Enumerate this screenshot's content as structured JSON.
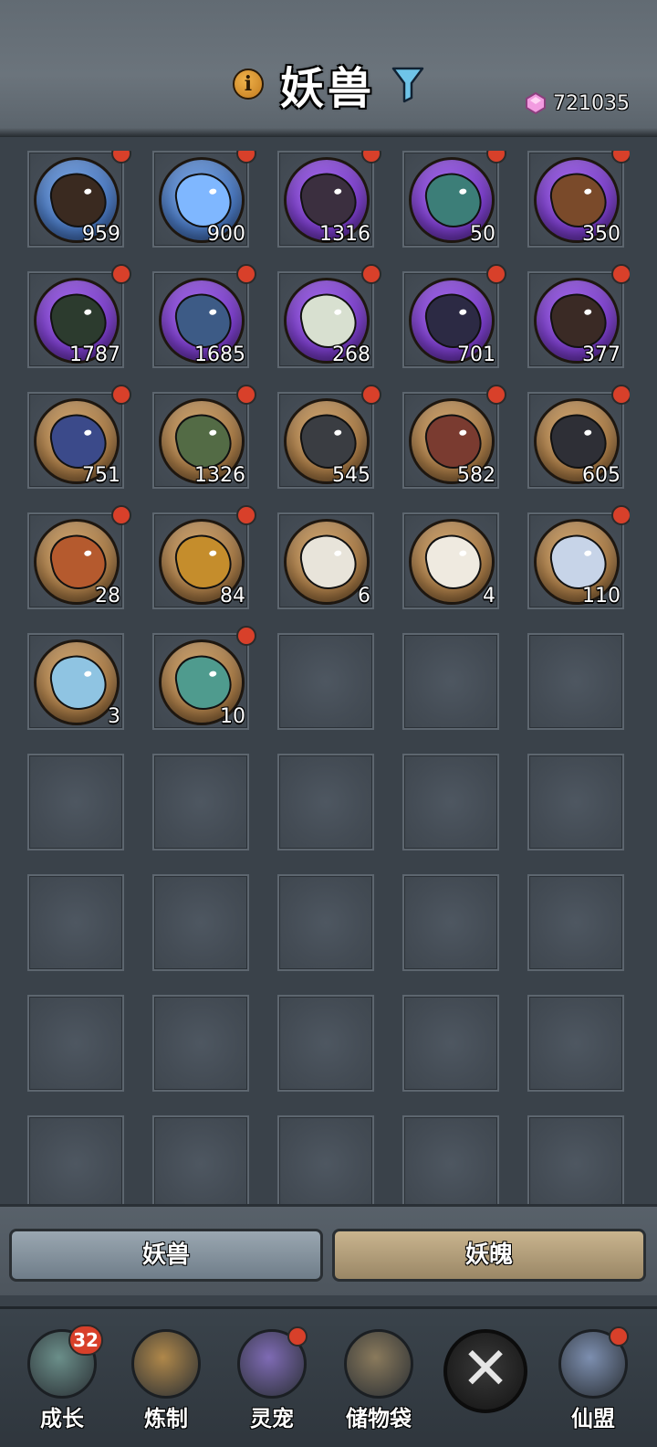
{
  "header": {
    "title": "妖兽",
    "info_icon": "i",
    "currency": {
      "icon": "pink-gem-icon",
      "value": "721035"
    }
  },
  "grid": {
    "slots": [
      {
        "count": "959",
        "orb": "blue",
        "beast_color": "#3a2a20",
        "badge": true
      },
      {
        "count": "900",
        "orb": "blue",
        "beast_color": "#7fb7ff",
        "badge": true
      },
      {
        "count": "1316",
        "orb": "purple",
        "beast_color": "#3b2f3f",
        "badge": true
      },
      {
        "count": "50",
        "orb": "purple",
        "beast_color": "#3c7e78",
        "badge": true
      },
      {
        "count": "350",
        "orb": "purple",
        "beast_color": "#7a4a2a",
        "badge": true
      },
      {
        "count": "1787",
        "orb": "purple",
        "beast_color": "#2c3b2e",
        "badge": true
      },
      {
        "count": "1685",
        "orb": "purple",
        "beast_color": "#3d5b86",
        "badge": true
      },
      {
        "count": "268",
        "orb": "purple",
        "beast_color": "#d8e0d0",
        "badge": true
      },
      {
        "count": "701",
        "orb": "purple",
        "beast_color": "#2c2a44",
        "badge": true
      },
      {
        "count": "377",
        "orb": "purple",
        "beast_color": "#3a2a25",
        "badge": true
      },
      {
        "count": "751",
        "orb": "tan",
        "beast_color": "#3b4a8a",
        "badge": true
      },
      {
        "count": "1326",
        "orb": "tan",
        "beast_color": "#536b45",
        "badge": true
      },
      {
        "count": "545",
        "orb": "tan",
        "beast_color": "#3a3d42",
        "badge": true
      },
      {
        "count": "582",
        "orb": "tan",
        "beast_color": "#7a3b30",
        "badge": true
      },
      {
        "count": "605",
        "orb": "tan",
        "beast_color": "#2e2f36",
        "badge": true
      },
      {
        "count": "28",
        "orb": "tan",
        "beast_color": "#b55a2e",
        "badge": true
      },
      {
        "count": "84",
        "orb": "tan",
        "beast_color": "#c58d2c",
        "badge": true
      },
      {
        "count": "6",
        "orb": "tan",
        "beast_color": "#e8e4da",
        "badge": false
      },
      {
        "count": "4",
        "orb": "tan",
        "beast_color": "#efeae0",
        "badge": false
      },
      {
        "count": "110",
        "orb": "tan",
        "beast_color": "#c7d4e8",
        "badge": true
      },
      {
        "count": "3",
        "orb": "tan",
        "beast_color": "#8fc4e2",
        "badge": false
      },
      {
        "count": "10",
        "orb": "tan",
        "beast_color": "#4f9b8e",
        "badge": true
      },
      {
        "count": "",
        "orb": "",
        "beast_color": "",
        "badge": false
      },
      {
        "count": "",
        "orb": "",
        "beast_color": "",
        "badge": false
      },
      {
        "count": "",
        "orb": "",
        "beast_color": "",
        "badge": false
      },
      {
        "count": "",
        "orb": "",
        "beast_color": "",
        "badge": false
      },
      {
        "count": "",
        "orb": "",
        "beast_color": "",
        "badge": false
      },
      {
        "count": "",
        "orb": "",
        "beast_color": "",
        "badge": false
      },
      {
        "count": "",
        "orb": "",
        "beast_color": "",
        "badge": false
      },
      {
        "count": "",
        "orb": "",
        "beast_color": "",
        "badge": false
      },
      {
        "count": "",
        "orb": "",
        "beast_color": "",
        "badge": false
      },
      {
        "count": "",
        "orb": "",
        "beast_color": "",
        "badge": false
      },
      {
        "count": "",
        "orb": "",
        "beast_color": "",
        "badge": false
      },
      {
        "count": "",
        "orb": "",
        "beast_color": "",
        "badge": false
      },
      {
        "count": "",
        "orb": "",
        "beast_color": "",
        "badge": false
      },
      {
        "count": "",
        "orb": "",
        "beast_color": "",
        "badge": false
      },
      {
        "count": "",
        "orb": "",
        "beast_color": "",
        "badge": false
      },
      {
        "count": "",
        "orb": "",
        "beast_color": "",
        "badge": false
      },
      {
        "count": "",
        "orb": "",
        "beast_color": "",
        "badge": false
      },
      {
        "count": "",
        "orb": "",
        "beast_color": "",
        "badge": false
      },
      {
        "count": "",
        "orb": "",
        "beast_color": "",
        "badge": false
      },
      {
        "count": "",
        "orb": "",
        "beast_color": "",
        "badge": false
      },
      {
        "count": "",
        "orb": "",
        "beast_color": "",
        "badge": false
      },
      {
        "count": "",
        "orb": "",
        "beast_color": "",
        "badge": false
      },
      {
        "count": "",
        "orb": "",
        "beast_color": "",
        "badge": false
      }
    ]
  },
  "tabs": {
    "left_label": "妖兽",
    "right_label": "妖魄"
  },
  "bottom_nav": {
    "items": [
      {
        "label": "成长",
        "icon": "growth-icon",
        "icon_color": "#6b8f8a",
        "badge_count": "32"
      },
      {
        "label": "炼制",
        "icon": "forge-icon",
        "icon_color": "#b0884a"
      },
      {
        "label": "灵宠",
        "icon": "spirit-pet-icon",
        "icon_color": "#7f6bb5"
      },
      {
        "label": "储物袋",
        "icon": "storage-bag-icon",
        "icon_color": "#8a7a5c"
      },
      {
        "label": "仙盟",
        "icon": "alliance-icon",
        "icon_color": "#7d8fb0"
      }
    ],
    "close_icon": "close-icon",
    "close_glyph": "✕"
  },
  "colors": {
    "badge_red": "#d8402a",
    "background": "#3a424a",
    "active_tab": "#8997a2",
    "inactive_tab": "#bda97f"
  }
}
